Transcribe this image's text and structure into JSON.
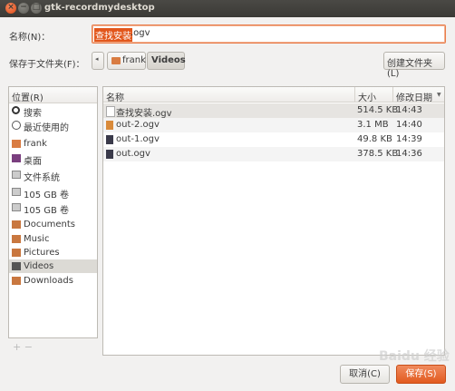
{
  "window": {
    "title": "gtk-recordmydesktop"
  },
  "filename": {
    "label": "名称(N)：",
    "selected_text": "查找安装",
    "rest_text": ".ogv"
  },
  "save_in": {
    "label": "保存于文件夹(F)：",
    "back_label": "◂",
    "path": [
      "frank",
      "Videos"
    ],
    "create_folder_label": "创建文件夹(L)"
  },
  "places": {
    "header": "位置(R)",
    "items": [
      {
        "label": "搜索",
        "icon": "search-icon"
      },
      {
        "label": "最近使用的",
        "icon": "recent-icon"
      },
      {
        "label": "frank",
        "icon": "home-folder-icon"
      },
      {
        "label": "桌面",
        "icon": "desktop-icon"
      },
      {
        "label": "文件系统",
        "icon": "drive-icon"
      },
      {
        "label": "105 GB 卷",
        "icon": "drive-icon"
      },
      {
        "label": "105 GB 卷",
        "icon": "drive-icon"
      },
      {
        "label": "Documents",
        "icon": "documents-folder-icon"
      },
      {
        "label": "Music",
        "icon": "music-folder-icon"
      },
      {
        "label": "Pictures",
        "icon": "pictures-folder-icon"
      },
      {
        "label": "Videos",
        "icon": "videos-folder-icon"
      },
      {
        "label": "Downloads",
        "icon": "downloads-folder-icon"
      }
    ],
    "add_label": "+ −"
  },
  "files": {
    "columns": {
      "name": "名称",
      "size": "大小",
      "date": "修改日期"
    },
    "rows": [
      {
        "name": "查找安装.ogv",
        "size": "514.5 KB",
        "date": "14:43"
      },
      {
        "name": "out-2.ogv",
        "size": "3.1 MB",
        "date": "14:40"
      },
      {
        "name": "out-1.ogv",
        "size": "49.8 KB",
        "date": "14:39"
      },
      {
        "name": "out.ogv",
        "size": "378.5 KB",
        "date": "14:36"
      }
    ]
  },
  "buttons": {
    "cancel": "取消(C)",
    "save": "保存(S)"
  },
  "watermark": "Baidu 经验"
}
